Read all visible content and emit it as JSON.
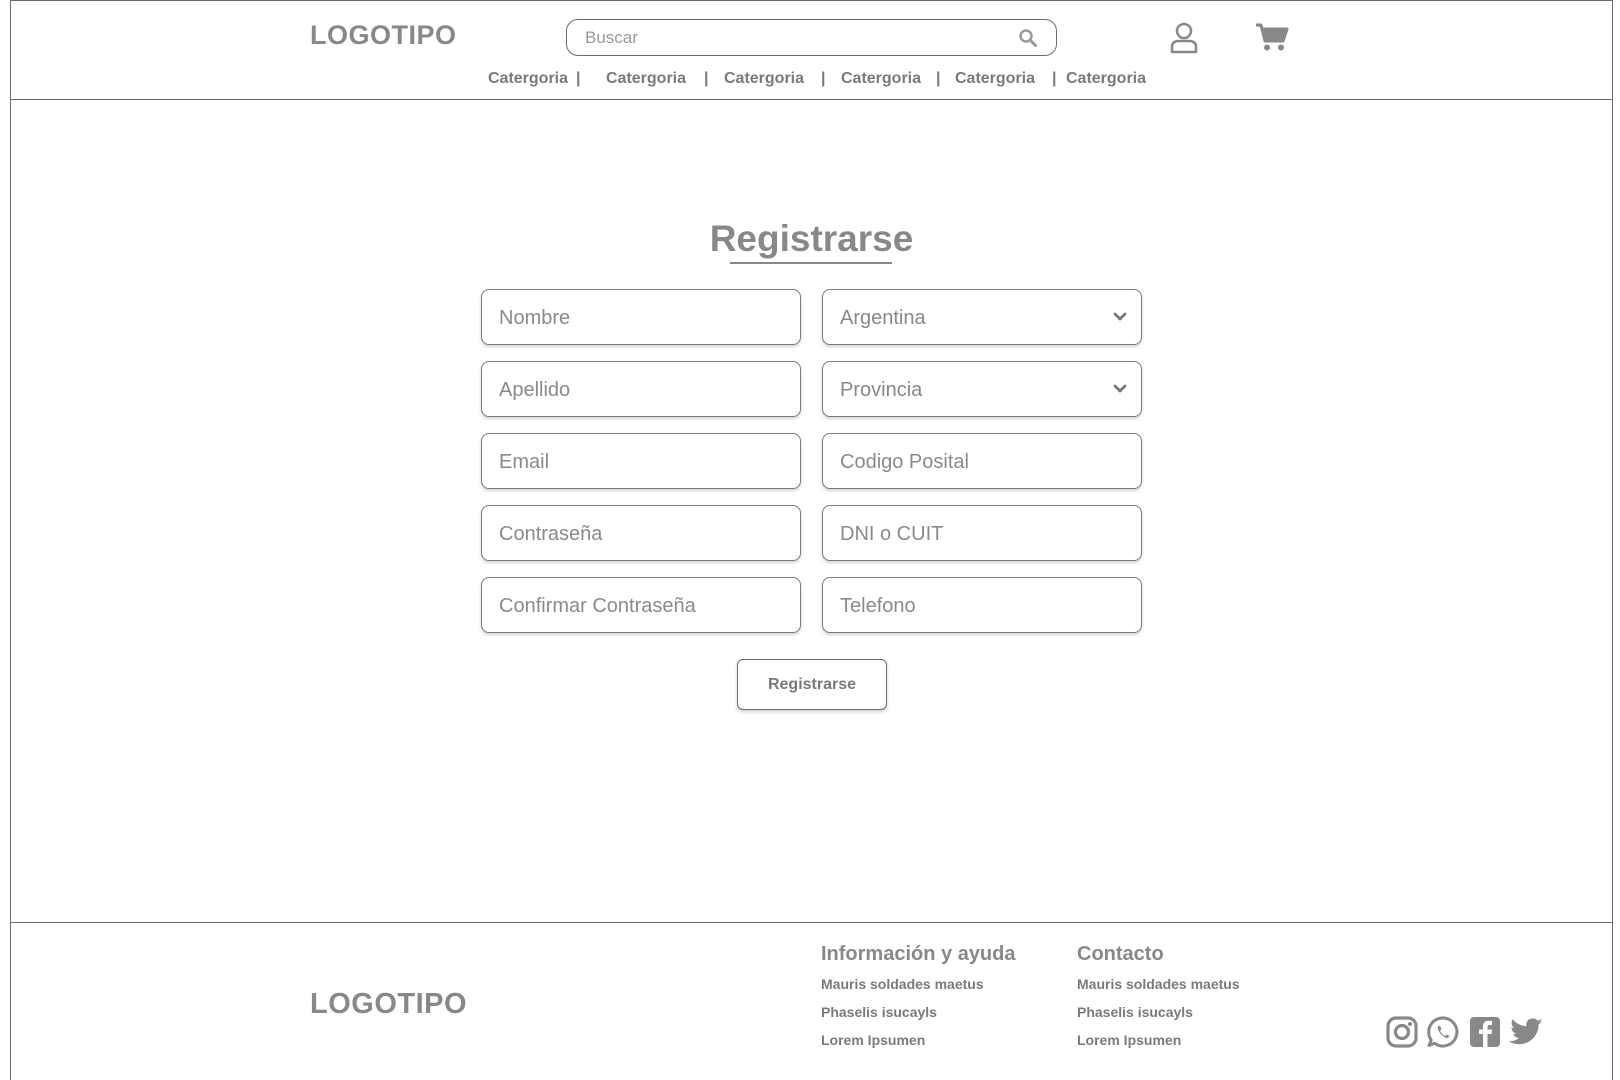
{
  "header": {
    "logo": "LOGOTIPO",
    "search_placeholder": "Buscar",
    "nav": [
      "Catergoria",
      "Catergoria",
      "Catergoria",
      "Catergoria",
      "Catergoria",
      "Catergoria"
    ],
    "separator": "|",
    "icons": [
      "search-icon",
      "user-icon",
      "cart-icon"
    ]
  },
  "form": {
    "title": "Registrarse",
    "fields": {
      "nombre": "Nombre",
      "apellido": "Apellido",
      "email": "Email",
      "contrasena": "Contraseña",
      "confirmar": "Confirmar Contraseña",
      "pais": "Argentina",
      "provincia": "Provincia",
      "codigo_postal": "Codigo Posital",
      "dni": "DNI o CUIT",
      "telefono": "Telefono"
    },
    "submit_label": "Registrarse"
  },
  "footer": {
    "logo": "LOGOTIPO",
    "info": {
      "title": "Información y ayuda",
      "links": [
        "Mauris soldades maetus",
        "Phaselis isucayls",
        "Lorem Ipsumen"
      ]
    },
    "contact": {
      "title": "Contacto",
      "links": [
        "Mauris soldades maetus",
        "Phaselis isucayls",
        "Lorem Ipsumen"
      ]
    },
    "social_icons": [
      "instagram-icon",
      "whatsapp-icon",
      "facebook-icon",
      "twitter-icon"
    ]
  },
  "colors": {
    "text": "#888888",
    "border": "#6b6b6b",
    "background": "#ffffff"
  }
}
